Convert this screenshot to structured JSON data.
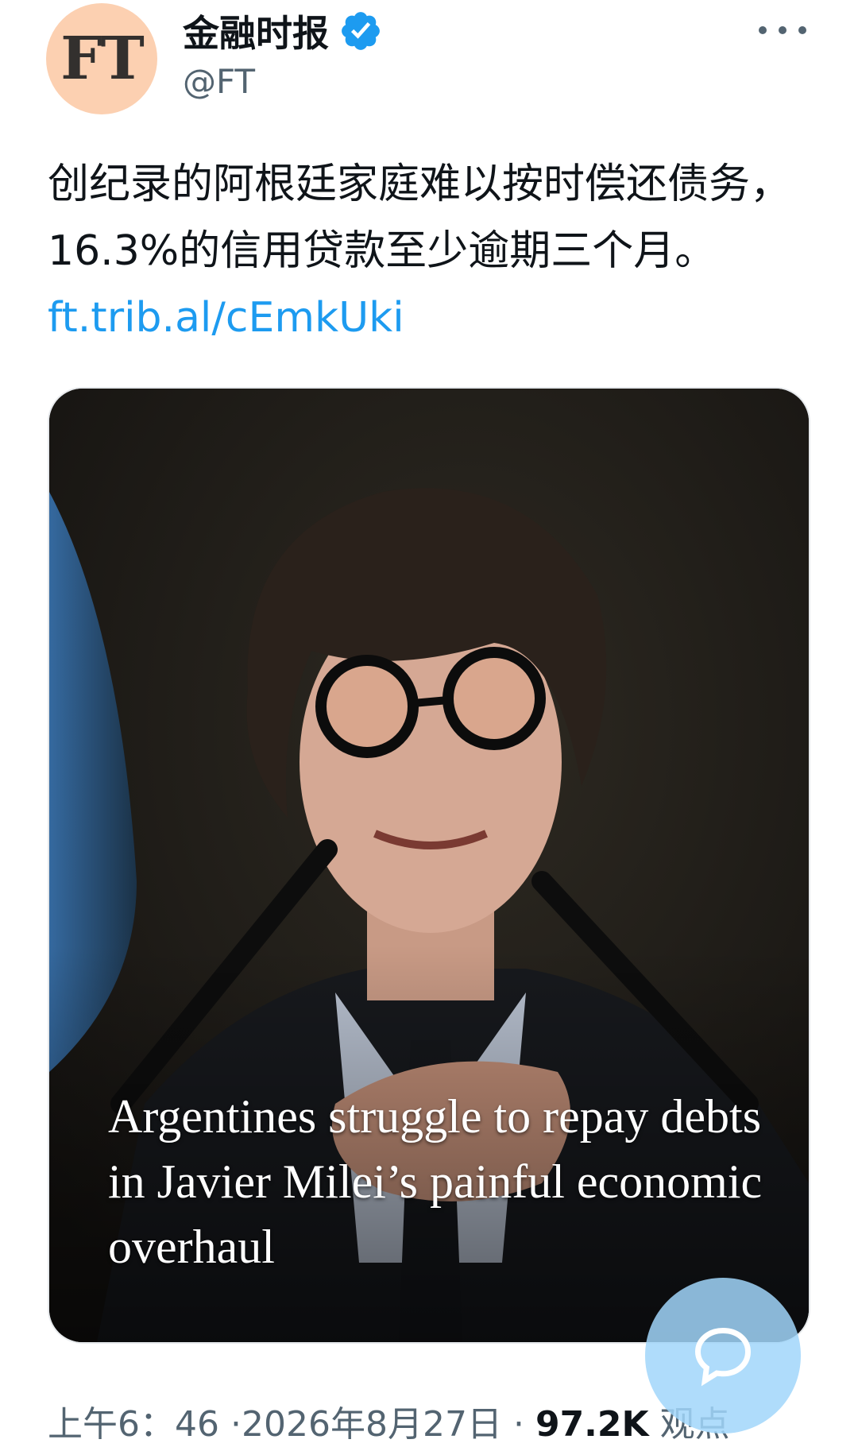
{
  "author": {
    "avatar_text": "FT",
    "display_name": "金融时报",
    "handle": "@FT",
    "verified_icon": "verified-badge-icon"
  },
  "menu_icon": "more-options-icon",
  "tweet": {
    "text": "创纪录的阿根廷家庭难以按时偿还债务，16.3%的信用贷款至少逾期三个月。",
    "link": "ft.trib.al/cEmkUki"
  },
  "media": {
    "headline": "Argentines struggle to repay debts in Javier Milei’s painful economic overhaul"
  },
  "footer": {
    "time": "上午6：46",
    "separator1": "·",
    "date": "2026年8月27日",
    "separator2": "·",
    "views_count": "97.2K",
    "views_label": "观点"
  },
  "fab_icon": "compose-reply-icon",
  "colors": {
    "link": "#1d9bf0",
    "avatar_bg": "#fcd0b1",
    "verified": "#1d9bf0",
    "secondary_text": "#536471"
  }
}
